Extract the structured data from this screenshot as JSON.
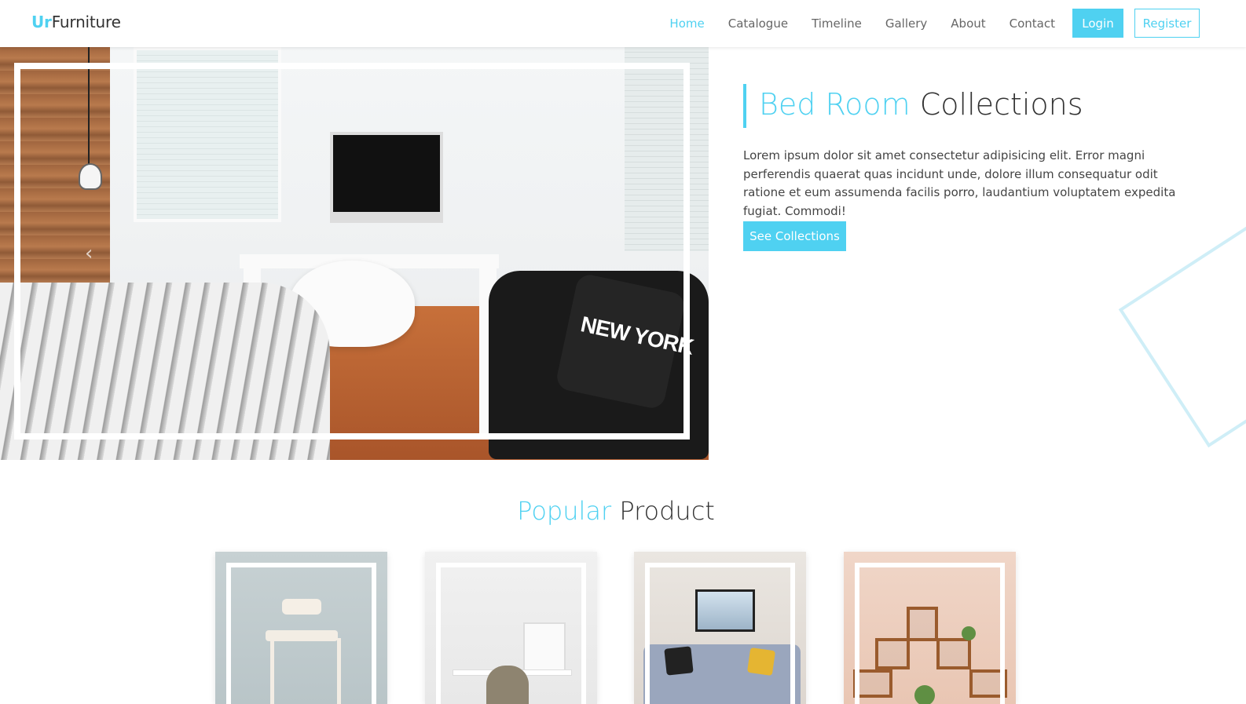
{
  "brand": {
    "prefix": "Ur",
    "name": "Furniture"
  },
  "nav": {
    "links": [
      {
        "label": "Home",
        "active": true
      },
      {
        "label": "Catalogue",
        "active": false
      },
      {
        "label": "Timeline",
        "active": false
      },
      {
        "label": "Gallery",
        "active": false
      },
      {
        "label": "About",
        "active": false
      },
      {
        "label": "Contact",
        "active": false
      }
    ],
    "login": "Login",
    "register": "Register"
  },
  "hero": {
    "pillow_text": "NEW YORK",
    "prev_icon": "‹",
    "title_accent": "Bed Room",
    "title_rest": "Collections",
    "description": "Lorem ipsum dolor sit amet consectetur adipisicing elit. Error magni perferendis quaerat quas incidunt unde, dolore illum consequatur odit ratione et eum assumenda facilis porro, laudantium voluptatem expedita fugiat. Commodi!",
    "cta": "See Collections"
  },
  "popular": {
    "title_accent": "Popular",
    "title_rest": "Product"
  },
  "colors": {
    "accent": "#4fd1f1",
    "text": "#333333",
    "nav_text": "#666666"
  }
}
